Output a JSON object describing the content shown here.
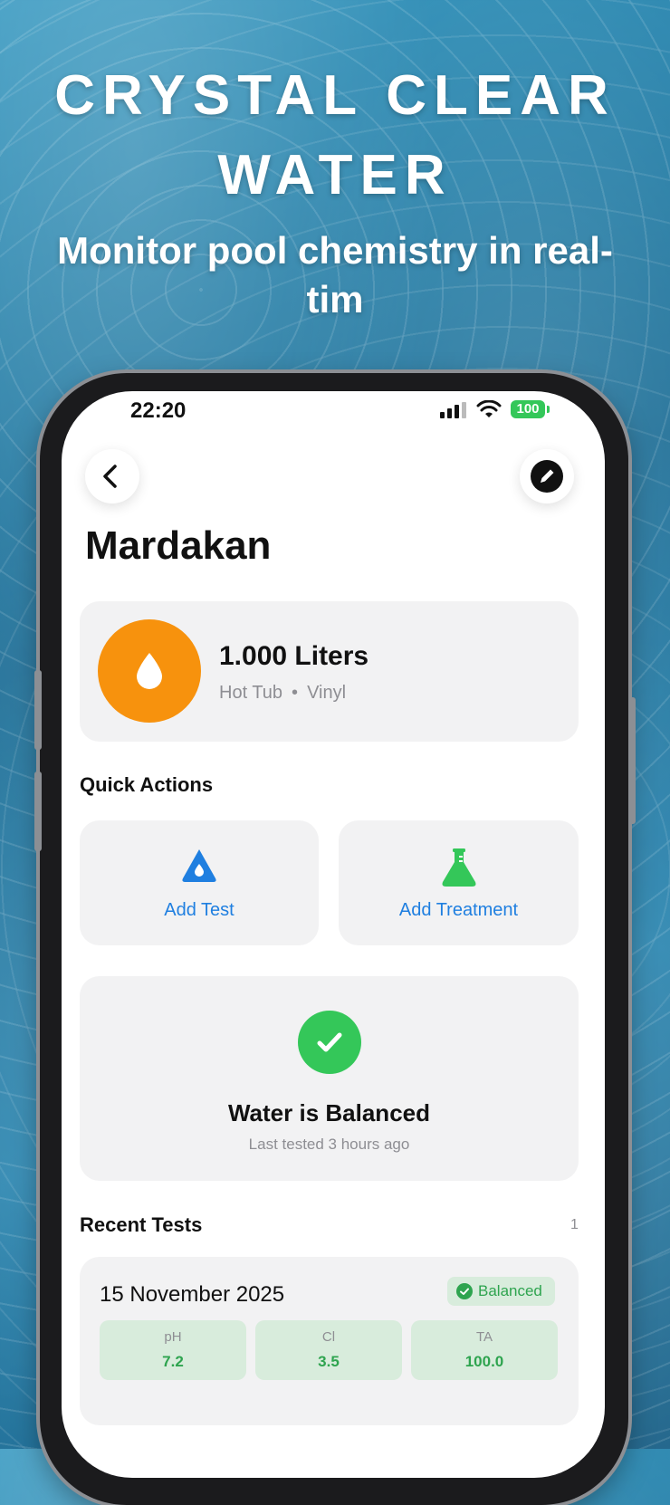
{
  "headline": {
    "title": "CRYSTAL CLEAR WATER",
    "subtitle": "Monitor pool chemistry in real-tim"
  },
  "status_bar": {
    "time": "22:20",
    "battery": "100"
  },
  "pool": {
    "name": "Mardakan",
    "volume": "1.000 Liters",
    "type": "Hot Tub",
    "separator": "•",
    "surface": "Vinyl"
  },
  "quick_actions": {
    "title": "Quick Actions",
    "items": [
      {
        "label": "Add Test",
        "icon": "water-drop-icon"
      },
      {
        "label": "Add Treatment",
        "icon": "flask-icon"
      }
    ]
  },
  "balance": {
    "title": "Water is Balanced",
    "subtitle": "Last tested 3 hours ago"
  },
  "recent_tests": {
    "title": "Recent Tests",
    "count": "1",
    "items": [
      {
        "date": "15 November 2025",
        "status": "Balanced",
        "metrics": [
          {
            "key": "pH",
            "value": "7.2"
          },
          {
            "key": "Cl",
            "value": "3.5"
          },
          {
            "key": "TA",
            "value": "100.0"
          }
        ]
      }
    ]
  },
  "colors": {
    "accent_blue": "#1f7fe0",
    "drop_orange": "#f7920d",
    "success_green": "#34c759",
    "metric_green": "#2ea44f"
  }
}
